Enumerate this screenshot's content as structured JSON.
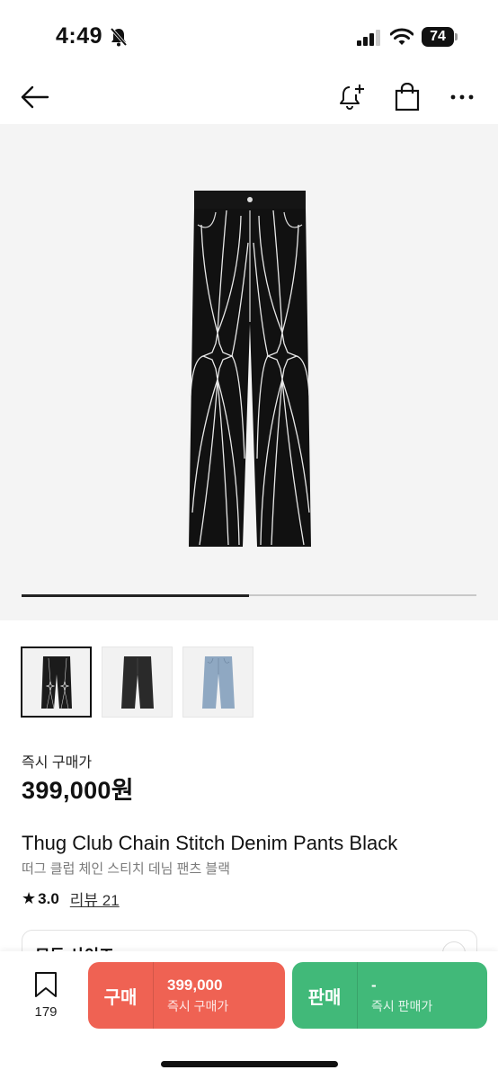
{
  "status_bar": {
    "time": "4:49",
    "battery": "74",
    "icons": [
      "bell-off-icon",
      "signal-icon",
      "wifi-icon",
      "battery-icon"
    ]
  },
  "nav": {
    "icons": [
      "back-arrow-icon",
      "bell-plus-icon",
      "shopping-bag-icon",
      "more-icon"
    ]
  },
  "gallery": {
    "progress": 0.5,
    "thumbnails": [
      {
        "name": "black pants with star stitching",
        "color": "#1b1b1b",
        "active": true
      },
      {
        "name": "black denim pants",
        "color": "#2a2a2a",
        "active": false
      },
      {
        "name": "blue denim pants",
        "color": "#8fa8c2",
        "active": false
      }
    ]
  },
  "product": {
    "price_label": "즉시 구매가",
    "price": "399,000원",
    "title_en": "Thug Club Chain Stitch Denim Pants Black",
    "title_ko": "떠그 클럽 체인 스티치 데님 팬츠 블랙",
    "rating": "3.0",
    "reviews": "리뷰 21"
  },
  "size_selector": {
    "label": "모든 사이즈"
  },
  "bottom_bar": {
    "bookmark_count": "179",
    "buy": {
      "label": "구매",
      "price": "399,000",
      "sub": "즉시 구매가",
      "color": "#ef6253"
    },
    "sell": {
      "label": "판매",
      "price": "-",
      "sub": "즉시 판매가",
      "color": "#41b979"
    }
  }
}
